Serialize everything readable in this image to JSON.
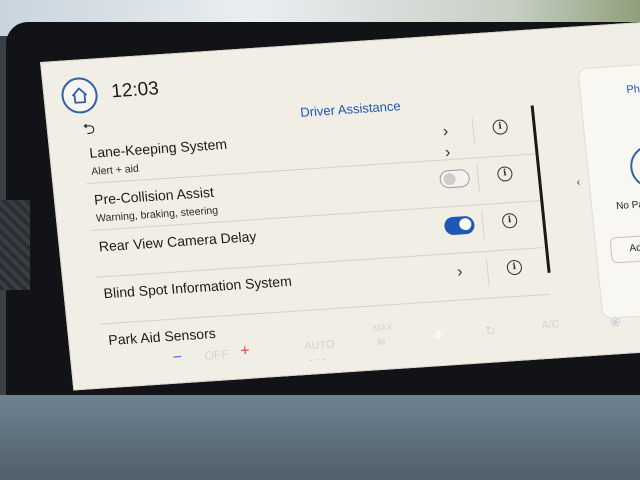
{
  "header": {
    "time": "12:03",
    "title": "Driver Assistance"
  },
  "settings": [
    {
      "label": "Lane-Keeping System",
      "sublabel": "Alert + aid",
      "control": "chevron"
    },
    {
      "label": "Pre-Collision Assist",
      "sublabel": "Warning, braking, steering",
      "control": "toggle",
      "enabled": false
    },
    {
      "label": "Rear View Camera Delay",
      "sublabel": "",
      "control": "toggle",
      "enabled": true
    },
    {
      "label": "Blind Spot Information System",
      "sublabel": "",
      "control": "chevron"
    },
    {
      "label": "Park Aid Sensors",
      "sublabel": "",
      "control": "none"
    }
  ],
  "phone_panel": {
    "title": "Pho",
    "status": "No Paired P",
    "add_label": "Add Phon"
  },
  "climate": {
    "off_label": "OFF",
    "auto_label": "AUTO",
    "max_label": "MAX",
    "ac_label": "A/C"
  },
  "colors": {
    "accent": "#1f57b5",
    "screen_bg": "#f1eee6",
    "toggle_on": "#1f57b5"
  },
  "icons": {
    "home": "home-icon",
    "back": "back-arrow-icon",
    "info": "info-icon",
    "chevron": "chevron-right-icon",
    "phone": "phone-icon"
  }
}
